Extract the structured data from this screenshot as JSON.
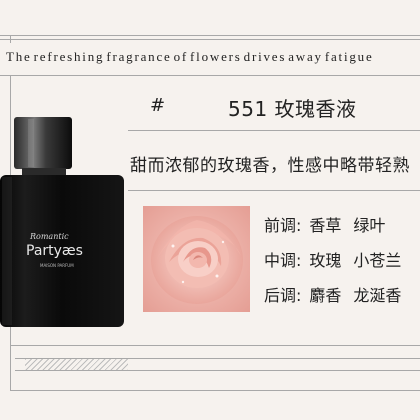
{
  "tagline": [
    "The",
    "refreshing",
    "fragrance",
    "of",
    "flowers",
    "drives",
    "away",
    "fatigue"
  ],
  "product": {
    "hash_symbol": "#",
    "name": "551 玫瑰香液"
  },
  "description": "甜而浓郁的玫瑰香，性感中略带轻熟",
  "bottle": {
    "brand_text": "Romantic",
    "logo_text": "Partyæs",
    "subtext": "MAISON PARFUM"
  },
  "notes": [
    {
      "label": "前调:",
      "values": [
        "香草",
        "绿叶"
      ]
    },
    {
      "label": "中调:",
      "values": [
        "玫瑰",
        "小苍兰"
      ]
    },
    {
      "label": "后调:",
      "values": [
        "麝香",
        "龙涎香"
      ]
    }
  ],
  "progress": {
    "fill_fraction": 0.26
  },
  "colors": {
    "background": "#f6f2ee",
    "rule": "#a8a8a8",
    "bottle": "#111111",
    "rose": "#e8a59a"
  }
}
